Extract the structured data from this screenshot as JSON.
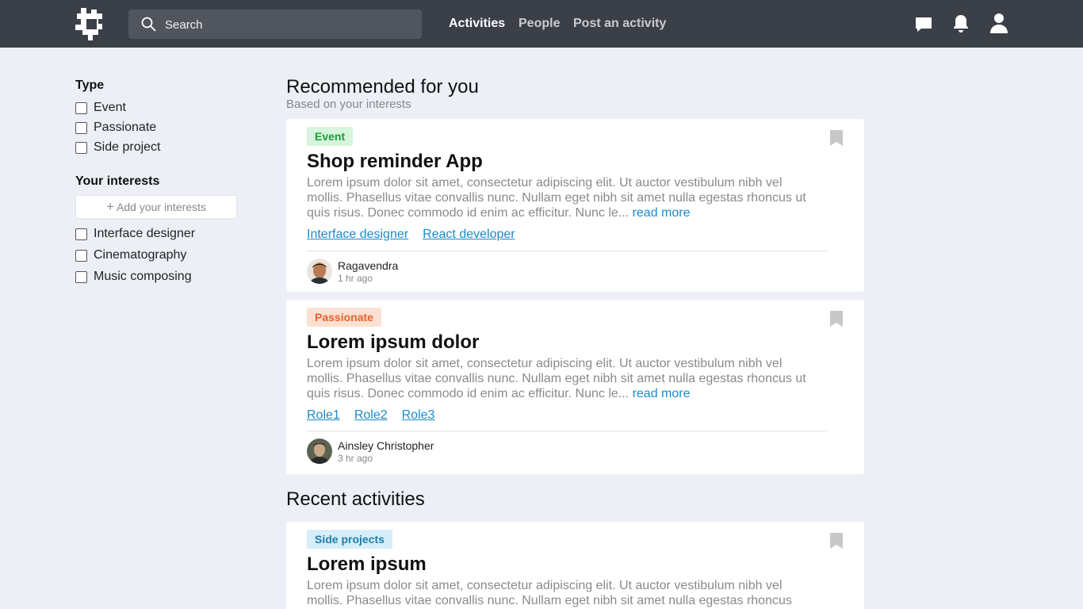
{
  "header": {
    "logo_icon": "puzzle-logo-icon",
    "search_placeholder": "Search",
    "nav": [
      {
        "label": "Activities",
        "active": true
      },
      {
        "label": "People",
        "active": false
      },
      {
        "label": "Post an activity",
        "active": false
      }
    ],
    "icons": [
      "chat-icon",
      "bell-icon",
      "user-icon"
    ]
  },
  "sidebar": {
    "type_heading": "Type",
    "types": [
      {
        "label": "Event",
        "checked": false
      },
      {
        "label": "Passionate",
        "checked": false
      },
      {
        "label": "Side project",
        "checked": false
      }
    ],
    "interests_heading": "Your interests",
    "add_interest_label": "Add your interests",
    "interests": [
      {
        "label": "Interface designer",
        "checked": false
      },
      {
        "label": "Cinematography",
        "checked": false
      },
      {
        "label": "Music composing",
        "checked": false
      }
    ]
  },
  "main": {
    "recommended_title": "Recommended for you",
    "recommended_subtitle": "Based on your interests",
    "recent_title": "Recent activities",
    "cards": [
      {
        "tag": "Event",
        "title": "Shop reminder App",
        "description": "Lorem ipsum dolor sit amet, consectetur adipiscing elit. Ut auctor vestibulum nibh vel mollis. Phasellus vitae convallis nunc. Nullam eget nibh sit amet nulla egestas rhoncus ut quis risus. Donec commodo id enim ac efficitur. Nunc le...",
        "read_more": "read more",
        "roles": [
          "Interface designer",
          "React developer"
        ],
        "author": "Ragavendra",
        "time": "1 hr ago"
      },
      {
        "tag": "Passionate",
        "title": "Lorem ipsum dolor",
        "description": "Lorem ipsum dolor sit amet, consectetur adipiscing elit. Ut auctor vestibulum nibh vel mollis. Phasellus vitae convallis nunc. Nullam eget nibh sit amet nulla egestas rhoncus ut quis risus. Donec commodo id enim ac efficitur. Nunc le...",
        "read_more": "read more",
        "roles": [
          "Role1",
          "Role2",
          "Role3"
        ],
        "author": "Ainsley Christopher",
        "time": "3 hr ago"
      },
      {
        "tag": "Side projects",
        "title": "Lorem ipsum",
        "description": "Lorem ipsum dolor sit amet, consectetur adipiscing elit. Ut auctor vestibulum nibh vel mollis. Phasellus vitae convallis nunc. Nullam eget nibh sit amet nulla egestas rhoncus"
      }
    ]
  },
  "colors": {
    "topbar": "#3a3f48",
    "background": "#eceff5",
    "link": "#1a8ac9",
    "event_tag": "#1f9b3b",
    "passionate_tag": "#e2622b",
    "side_tag": "#1d7fab"
  }
}
